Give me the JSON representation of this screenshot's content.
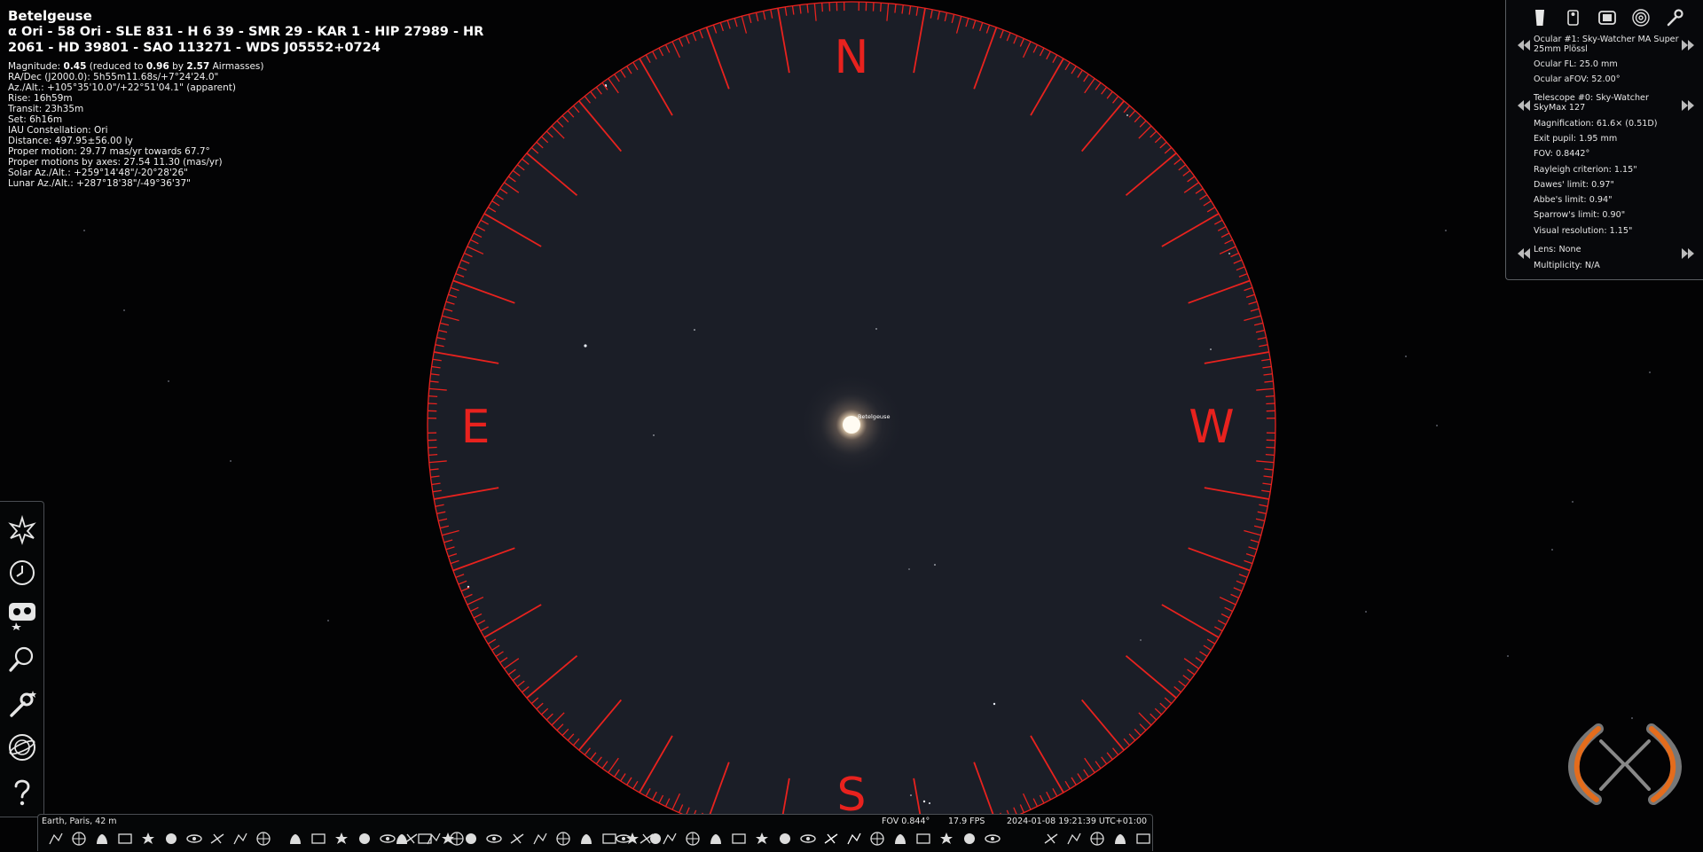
{
  "object": {
    "name": "Betelgeuse",
    "designations": "α Ori - 58 Ori - SLE 831 - H 6 39 - SMR 29 - KAR 1 - HIP 27989 - HR 2061 - HD 39801 - SAO 113271 - WDS J05552+0724",
    "details": [
      {
        "label": "Magnitude: ",
        "v1": "0.45",
        "t1": " (reduced to ",
        "v2": "0.96",
        "t2": " by ",
        "v3": "2.57",
        "t3": " Airmasses)"
      },
      {
        "text": "RA/Dec (J2000.0): 5h55m11.68s/+7°24'24.0\""
      },
      {
        "text": "Az./Alt.: +105°35'10.0\"/+22°51'04.1\" (apparent)"
      },
      {
        "text": "Rise: 16h59m"
      },
      {
        "text": "Transit: 23h35m"
      },
      {
        "text": "Set: 6h16m"
      },
      {
        "text": "IAU Constellation: Ori"
      },
      {
        "text": "Distance: 497.95±56.00 ly"
      },
      {
        "text": "Proper motion: 29.77 mas/yr towards 67.7°"
      },
      {
        "text": "Proper motions by axes: 27.54 11.30 (mas/yr)"
      },
      {
        "text": "Solar Az./Alt.: +259°14'48\"/-20°28'26\""
      },
      {
        "text": "Lunar Az./Alt.: +287°18'38\"/-49°36'37\""
      }
    ]
  },
  "sky": {
    "star_label": "Betelgeuse",
    "compass": {
      "north": "N",
      "south": "S",
      "east": "E",
      "west": "W"
    },
    "ring_color": "#e8221e",
    "field_color": "#1b1e27"
  },
  "oculars_panel": {
    "icons": [
      "ocular-icon",
      "telescope-icon",
      "sensor-icon",
      "telrad-icon",
      "configure-icon"
    ],
    "ocular_name": "Ocular #1: Sky-Watcher MA Super 25mm Plössl",
    "ocular_fl": "Ocular FL: 25.0 mm",
    "ocular_afov": "Ocular aFOV: 52.00°",
    "telescope_name": "Telescope #0: Sky-Watcher SkyMax 127",
    "stats": [
      "Magnification: 61.6× (0.51D)",
      "Exit pupil: 1.95 mm",
      "FOV: 0.8442°",
      "Rayleigh criterion: 1.15\"",
      "Dawes' limit: 0.97\"",
      "Abbe's limit: 0.94\"",
      "Sparrow's limit: 0.90\"",
      "Visual resolution: 1.15\""
    ],
    "lens": "Lens: None",
    "multiplicity": "Multiplicity: N/A"
  },
  "left_toolbar": {
    "icons": [
      "sky-viewing-options-icon",
      "date-time-icon",
      "location-sky-icon",
      "search-icon",
      "configuration-icon",
      "astronomical-calculations-icon",
      "help-icon"
    ]
  },
  "status_bar": {
    "location": "Earth, Paris, 42 m",
    "fov": "FOV 0.844°",
    "fps": "17.9 FPS",
    "datetime": "2024-01-08 19:21:39 UTC+01:00"
  },
  "bottom_toolbar": {
    "icons": [
      "constellation-lines-icon",
      "constellation-labels-icon",
      "constellation-art-icon",
      "constellation-boundaries-icon",
      "asterism-lines-icon",
      "asterism-labels-icon",
      "equatorial-grid-icon",
      "azimuthal-grid-icon",
      "ecliptic-grid-icon",
      "galactic-grid-icon",
      "cardinal-points-icon",
      "ground-icon",
      "atmosphere-icon",
      "fog-icon",
      "meteor-icon",
      "star-icon",
      "nebulae-icon",
      "dso-backgrounds-icon",
      "planet-labels-icon",
      "satellites-icon",
      "exoplanets-icon",
      "dss-survey-icon",
      "hips-survey-icon",
      "deep-sky-icon",
      "observing-list-icon",
      "eye-icon",
      "equatorial-mount-icon",
      "center-object-icon",
      "flip-horizontal-icon",
      "flip-vertical-icon",
      "angle-measure-icon",
      "bookmarks-icon",
      "catalog-icon",
      "telescope-control-icon",
      "planet-icon",
      "eyepiece-icon",
      "search-ocular-icon",
      "rotation-icon",
      "finder-icon",
      "ocular-view-icon",
      "crosshair-icon",
      "telrad-toggle-icon",
      "fullscreen-icon",
      "night-mode-icon",
      "running-man-icon",
      "satellite-icon",
      "binoculars-icon",
      "rewind-icon",
      "pause-icon",
      "real-time-icon",
      "forward-icon",
      "quit-icon"
    ]
  }
}
